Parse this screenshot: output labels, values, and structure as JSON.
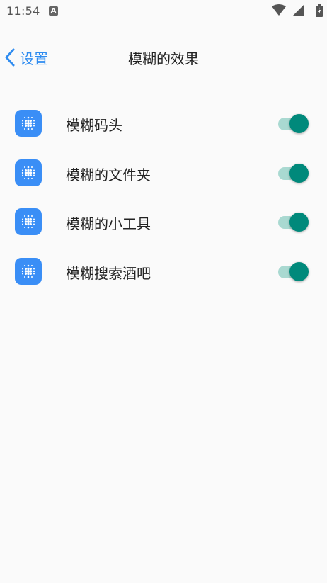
{
  "status_bar": {
    "time": "11:54",
    "notification_icon": "A",
    "icons": [
      "wifi-icon",
      "cell-signal-icon",
      "battery-charging-icon"
    ]
  },
  "toolbar": {
    "back_label": "设置",
    "title": "模糊的效果"
  },
  "colors": {
    "accent": "#2f8cf0",
    "icon_bg": "#3a8ef6",
    "toggle_thumb": "#00897b",
    "toggle_track": "#a9d9d1"
  },
  "items": [
    {
      "label": "模糊码头",
      "icon": "dot-grid-icon",
      "enabled": true
    },
    {
      "label": "模糊的文件夹",
      "icon": "dot-grid-icon",
      "enabled": true
    },
    {
      "label": "模糊的小工具",
      "icon": "dot-grid-icon",
      "enabled": true
    },
    {
      "label": "模糊搜索酒吧",
      "icon": "dot-grid-icon",
      "enabled": true
    }
  ]
}
